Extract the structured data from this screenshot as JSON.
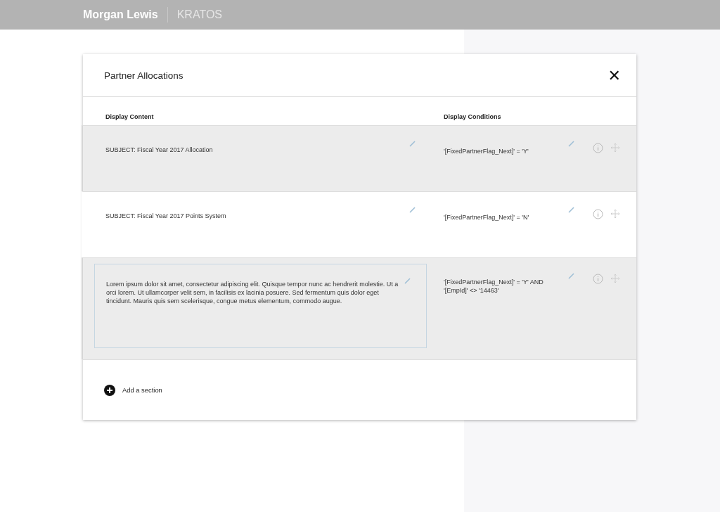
{
  "header": {
    "brand": "Morgan Lewis",
    "product": "KRATOS"
  },
  "dialog": {
    "title": "Partner Allocations",
    "close": "✕",
    "columns": [
      "Display Content",
      "Display Conditions"
    ],
    "rows": [
      {
        "content": "SUBJECT: Fiscal Year 2017 Allocation",
        "condition": "'[FixedPartnerFlag_Next]' = 'Y'",
        "shaded": true,
        "editing": false
      },
      {
        "content": "SUBJECT: Fiscal Year 2017 Points System",
        "condition": "'[FixedPartnerFlag_Next]' = 'N'",
        "shaded": false,
        "editing": false
      },
      {
        "content": "Lorem ipsum dolor sit amet, consectetur adipiscing elit. Quisque tempor nunc ac hendrerit molestie. Ut a orci lorem. Ut ullamcorper velit sem, in facilisis ex lacinia posuere. Sed fermentum quis dolor eget tincidunt. Mauris quis sem scelerisque, congue metus elementum, commodo augue.",
        "condition": "'[FixedPartnerFlag_Next]' = 'Y' AND '[EmpId]' <> '14463'",
        "shaded": true,
        "editing": true
      }
    ],
    "add_label": "Add a section"
  }
}
